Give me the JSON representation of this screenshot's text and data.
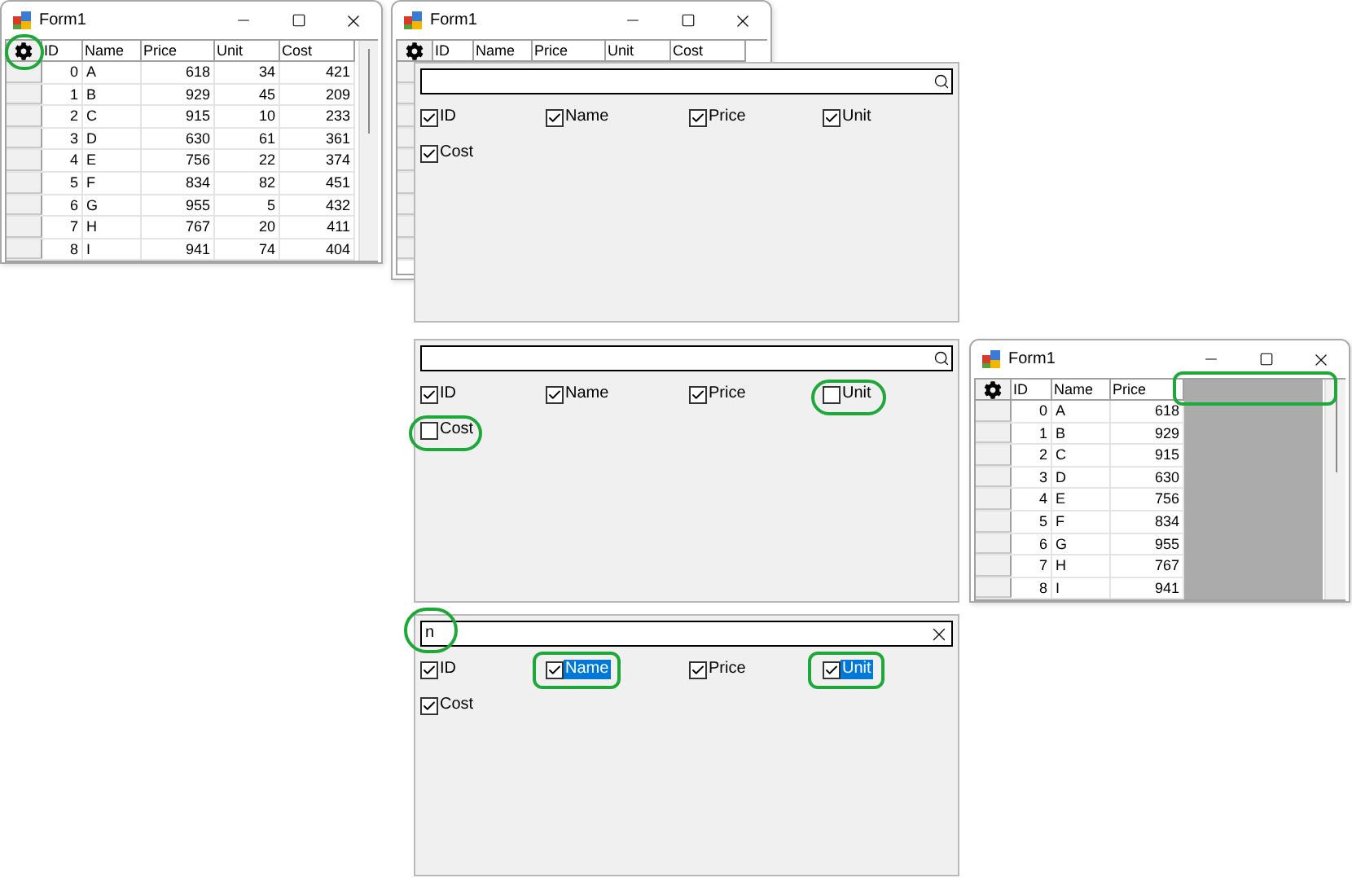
{
  "windows": [
    {
      "title": "Form1",
      "columns": [
        "ID",
        "Name",
        "Price",
        "Unit",
        "Cost"
      ],
      "blank_area": false,
      "rows": [
        [
          "0",
          "A",
          "618",
          "34",
          "421"
        ],
        [
          "1",
          "B",
          "929",
          "45",
          "209"
        ],
        [
          "2",
          "C",
          "915",
          "10",
          "233"
        ],
        [
          "3",
          "D",
          "630",
          "61",
          "361"
        ],
        [
          "4",
          "E",
          "756",
          "22",
          "374"
        ],
        [
          "5",
          "F",
          "834",
          "82",
          "451"
        ],
        [
          "6",
          "G",
          "955",
          "5",
          "432"
        ],
        [
          "7",
          "H",
          "767",
          "20",
          "411"
        ],
        [
          "8",
          "I",
          "941",
          "74",
          "404"
        ]
      ]
    },
    {
      "title": "Form1",
      "columns": [
        "ID",
        "Name",
        "Price",
        "Unit",
        "Cost"
      ],
      "blank_area": false
    },
    {
      "title": "Form1",
      "columns": [
        "ID",
        "Name",
        "Price"
      ],
      "blank_area": true,
      "rows": [
        [
          "0",
          "A",
          "618"
        ],
        [
          "1",
          "B",
          "929"
        ],
        [
          "2",
          "C",
          "915"
        ],
        [
          "3",
          "D",
          "630"
        ],
        [
          "4",
          "E",
          "756"
        ],
        [
          "5",
          "F",
          "834"
        ],
        [
          "6",
          "G",
          "955"
        ],
        [
          "7",
          "H",
          "767"
        ],
        [
          "8",
          "I",
          "941"
        ]
      ]
    }
  ],
  "panels": [
    {
      "items": [
        {
          "label": "ID",
          "checked": true,
          "highlighted": false
        },
        {
          "label": "Name",
          "checked": true,
          "highlighted": false
        },
        {
          "label": "Price",
          "checked": true,
          "highlighted": false
        },
        {
          "label": "Unit",
          "checked": true,
          "highlighted": false
        },
        {
          "label": "Cost",
          "checked": true,
          "highlighted": false
        }
      ]
    },
    {
      "items": [
        {
          "label": "ID",
          "checked": true,
          "highlighted": false
        },
        {
          "label": "Name",
          "checked": true,
          "highlighted": false
        },
        {
          "label": "Price",
          "checked": true,
          "highlighted": false
        },
        {
          "label": "Unit",
          "checked": false,
          "highlighted": false
        },
        {
          "label": "Cost",
          "checked": false,
          "highlighted": false
        }
      ]
    },
    {
      "search_text": "n",
      "items": [
        {
          "label": "ID",
          "checked": true,
          "highlighted": false
        },
        {
          "label": "Name",
          "checked": true,
          "highlighted": true
        },
        {
          "label": "Price",
          "checked": true,
          "highlighted": false
        },
        {
          "label": "Unit",
          "checked": true,
          "highlighted": true
        },
        {
          "label": "Cost",
          "checked": true,
          "highlighted": false
        }
      ]
    }
  ]
}
